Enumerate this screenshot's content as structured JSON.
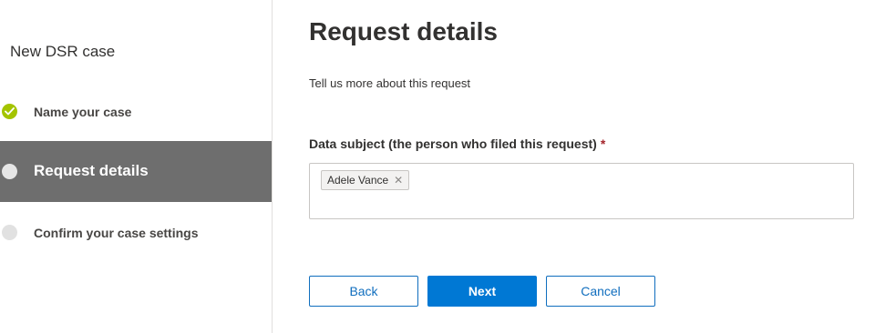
{
  "wizard": {
    "title": "New DSR case",
    "steps": [
      {
        "label": "Name your case",
        "state": "completed"
      },
      {
        "label": "Request details",
        "state": "current"
      },
      {
        "label": "Confirm your case settings",
        "state": "pending"
      }
    ]
  },
  "main": {
    "heading": "Request details",
    "subtitle": "Tell us more about this request",
    "field": {
      "label": "Data subject (the person who filed this request)",
      "required_marker": "*",
      "selected_person": "Adele Vance",
      "remove_glyph": "✕"
    }
  },
  "footer": {
    "back_label": "Back",
    "next_label": "Next",
    "cancel_label": "Cancel"
  },
  "colors": {
    "accent": "#0078d4",
    "completed": "#a4c400",
    "active_step_bg": "#6e6e6e",
    "required": "#a4262c"
  },
  "icons": {
    "completed_step": "checkmark-icon",
    "current_step": "circle-icon",
    "pending_step": "circle-icon",
    "remove_chip": "close-icon"
  }
}
